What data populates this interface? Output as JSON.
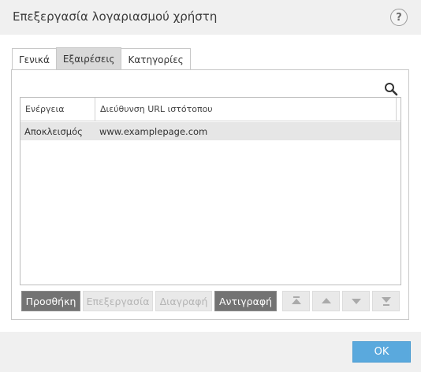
{
  "dialog": {
    "title": "Επεξεργασία λογαριασμού χρήστη",
    "help_label": "?"
  },
  "tabs": [
    {
      "label": "Γενικά",
      "active": false
    },
    {
      "label": "Εξαιρέσεις",
      "active": true
    },
    {
      "label": "Κατηγορίες",
      "active": false
    }
  ],
  "search": {
    "icon": "search-icon"
  },
  "table": {
    "columns": [
      "Ενέργεια",
      "Διεύθυνση URL ιστότοπου"
    ],
    "rows": [
      {
        "action": "Αποκλεισμός",
        "url": "www.examplepage.com",
        "selected": true
      }
    ]
  },
  "toolbar": {
    "add_label": "Προσθήκη",
    "edit_label": "Επεξεργασία",
    "delete_label": "Διαγραφή",
    "copy_label": "Αντιγραφή",
    "arrows": [
      "move-top-icon",
      "move-up-icon",
      "move-down-icon",
      "move-bottom-icon"
    ]
  },
  "footer": {
    "ok_label": "OK"
  },
  "colors": {
    "accent": "#5aa9dd",
    "primary_button": "#737373",
    "selected_row": "#e6e6e6"
  }
}
